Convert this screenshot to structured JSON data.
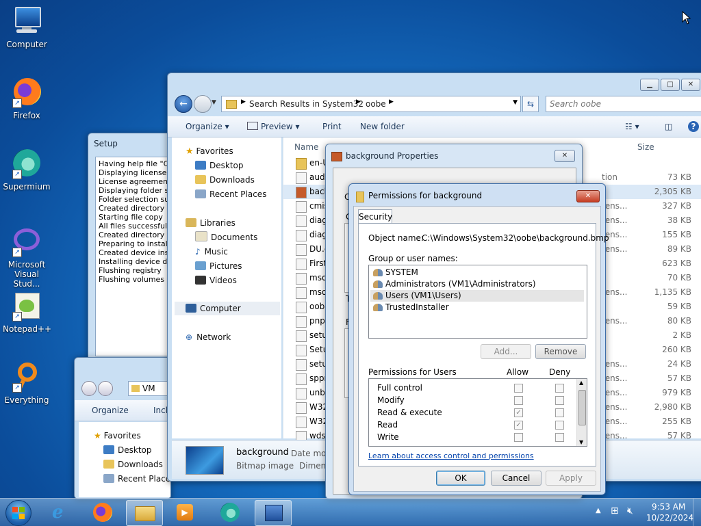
{
  "desktop": {
    "icons": [
      {
        "label": "Computer"
      },
      {
        "label": "Firefox"
      },
      {
        "label": "Supermium"
      },
      {
        "label": "Microsoft Visual Stud..."
      },
      {
        "label": "Notepad++"
      },
      {
        "label": "Everything"
      }
    ]
  },
  "setup": {
    "title": "Setup",
    "log": [
      "Having help file \"C:\\...",
      "Displaying license ag",
      "License agreement a",
      "Displaying folder sele",
      "Folder selection succ",
      "Created directory \"C",
      "Starting file copy",
      "All files successfully c",
      "Created directory \"C",
      "Preparing to install d",
      "Created device insta",
      "Installing device driv",
      "Flushing registry",
      "Flushing volumes"
    ]
  },
  "explorer": {
    "breadcrumb": [
      "Search Results in System32",
      "oobe"
    ],
    "search_placeholder": "Search oobe",
    "toolbar": {
      "organize": "Organize",
      "preview": "Preview",
      "print": "Print",
      "new_folder": "New folder"
    },
    "nav": {
      "favorites": "Favorites",
      "desktop": "Desktop",
      "downloads": "Downloads",
      "recent": "Recent Places",
      "libraries": "Libraries",
      "documents": "Documents",
      "music": "Music",
      "pictures": "Pictures",
      "videos": "Videos",
      "computer": "Computer",
      "network": "Network"
    },
    "columns": {
      "name": "Name",
      "size": "Size"
    },
    "files": [
      {
        "name": "en-U",
        "ext": "",
        "size": ""
      },
      {
        "name": "audi",
        "ext": "tion",
        "size": "73 KB"
      },
      {
        "name": "back",
        "ext": "",
        "size": "2,305 KB"
      },
      {
        "name": "cmis",
        "ext": "tens...",
        "size": "327 KB"
      },
      {
        "name": "diag",
        "ext": "tens...",
        "size": "38 KB"
      },
      {
        "name": "diag",
        "ext": "tens...",
        "size": "155 KB"
      },
      {
        "name": "DU.c",
        "ext": "tens...",
        "size": "89 KB"
      },
      {
        "name": "First",
        "ext": "",
        "size": "623 KB"
      },
      {
        "name": "mso",
        "ext": "",
        "size": "70 KB"
      },
      {
        "name": "mso",
        "ext": "tens...",
        "size": "1,135 KB"
      },
      {
        "name": "oobe",
        "ext": "",
        "size": "59 KB"
      },
      {
        "name": "pnpi",
        "ext": "tens...",
        "size": "80 KB"
      },
      {
        "name": "setu",
        "ext": "",
        "size": "2 KB"
      },
      {
        "name": "Setu",
        "ext": "",
        "size": "260 KB"
      },
      {
        "name": "setu",
        "ext": "tens...",
        "size": "24 KB"
      },
      {
        "name": "sppr",
        "ext": "tens...",
        "size": "57 KB"
      },
      {
        "name": "unbo",
        "ext": "tens...",
        "size": "979 KB"
      },
      {
        "name": "W32",
        "ext": "tens...",
        "size": "2,980 KB"
      },
      {
        "name": "W32",
        "ext": "tens...",
        "size": "255 KB"
      },
      {
        "name": "wdsu",
        "ext": "tens...",
        "size": "57 KB"
      }
    ],
    "details": {
      "filename": "background",
      "type": "Bitmap image",
      "date_label": "Date moc",
      "dims_label": "Dimens"
    }
  },
  "explorer2": {
    "breadcrumb": "VM",
    "organize": "Organize",
    "include": "Incl",
    "favorites": "Favorites",
    "desktop": "Desktop",
    "downloads": "Downloads",
    "recent": "Recent Places"
  },
  "properties": {
    "title": "background Properties",
    "tabs_stub": "C",
    "g_stub": "G",
    "t_stub": "T",
    "f_stub": "F"
  },
  "permissions": {
    "title": "Permissions for background",
    "tab": "Security",
    "object_label": "Object name:",
    "object_value": "C:\\Windows\\System32\\oobe\\background.bmp",
    "group_label": "Group or user names:",
    "users": [
      "SYSTEM",
      "Administrators (VM1\\Administrators)",
      "Users (VM1\\Users)",
      "TrustedInstaller"
    ],
    "add": "Add...",
    "remove": "Remove",
    "perm_header": "Permissions for Users",
    "allow": "Allow",
    "deny": "Deny",
    "perms": [
      {
        "name": "Full control",
        "allow": false
      },
      {
        "name": "Modify",
        "allow": false
      },
      {
        "name": "Read & execute",
        "allow": true
      },
      {
        "name": "Read",
        "allow": true
      },
      {
        "name": "Write",
        "allow": false
      }
    ],
    "link": "Learn about access control and permissions",
    "ok": "OK",
    "cancel": "Cancel",
    "apply": "Apply"
  },
  "taskbar": {
    "time": "9:53 AM",
    "date": "10/22/2024"
  }
}
